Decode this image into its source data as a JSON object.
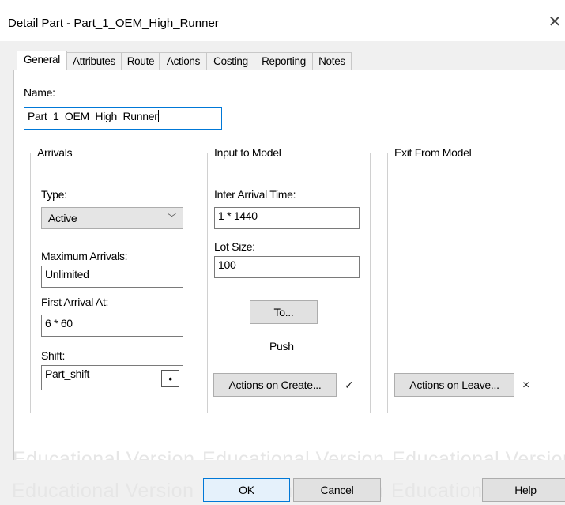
{
  "window": {
    "title": "Detail Part - Part_1_OEM_High_Runner",
    "close_glyph": "✕"
  },
  "tabs": [
    {
      "label": "General",
      "active": true
    },
    {
      "label": "Attributes"
    },
    {
      "label": "Route"
    },
    {
      "label": "Actions"
    },
    {
      "label": "Costing"
    },
    {
      "label": "Reporting"
    },
    {
      "label": "Notes"
    }
  ],
  "general": {
    "name_label": "Name:",
    "name_value": "Part_1_OEM_High_Runner"
  },
  "arrivals": {
    "title": "Arrivals",
    "type_label": "Type:",
    "type_value": "Active",
    "max_label": "Maximum Arrivals:",
    "max_value": "Unlimited",
    "first_label": "First Arrival At:",
    "first_value": "6 * 60",
    "shift_label": "Shift:",
    "shift_value": "Part_shift",
    "shift_button_glyph": "•"
  },
  "input_model": {
    "title": "Input to Model",
    "iat_label": "Inter Arrival Time:",
    "iat_value": "1 * 1440",
    "lot_label": "Lot Size:",
    "lot_value": "100",
    "to_button": "To...",
    "push_text": "Push",
    "actions_button": "Actions on Create...",
    "actions_mark": "✓"
  },
  "exit_model": {
    "title": "Exit From Model",
    "actions_button": "Actions on Leave...",
    "actions_mark": "×"
  },
  "footer": {
    "ok": "OK",
    "cancel": "Cancel",
    "help": "Help",
    "watermark": "Educational Version"
  }
}
